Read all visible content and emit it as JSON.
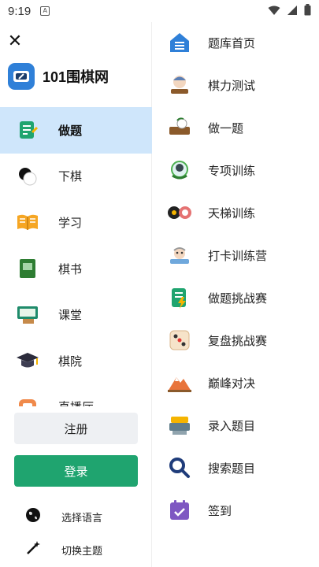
{
  "status_bar": {
    "time": "9:19",
    "notification_letter": "A"
  },
  "drawer": {
    "brand_name": "101围棋网",
    "menu": [
      {
        "label": "做题",
        "icon": "practice-icon",
        "active": true
      },
      {
        "label": "下棋",
        "icon": "go-stones-icon",
        "active": false
      },
      {
        "label": "学习",
        "icon": "open-book-icon",
        "active": false
      },
      {
        "label": "棋书",
        "icon": "go-book-icon",
        "active": false
      },
      {
        "label": "课堂",
        "icon": "classroom-icon",
        "active": false
      },
      {
        "label": "棋院",
        "icon": "graduation-cap-icon",
        "active": false
      },
      {
        "label": "直播厅",
        "icon": "live-hall-icon",
        "active": false
      }
    ],
    "register_label": "注册",
    "login_label": "登录",
    "language_label": "选择语言",
    "theme_label": "切换主题",
    "colors": {
      "active_bg": "#cfe6fb",
      "login_green": "#1fa46f",
      "register_bg": "#eef0f3"
    }
  },
  "panel": {
    "items": [
      {
        "label": "题库首页",
        "icon": "home-icon"
      },
      {
        "label": "棋力测试",
        "icon": "test-avatar-icon"
      },
      {
        "label": "做一题",
        "icon": "single-problem-icon"
      },
      {
        "label": "专项训练",
        "icon": "special-training-icon"
      },
      {
        "label": "天梯训练",
        "icon": "ladder-training-icon"
      },
      {
        "label": "打卡训练营",
        "icon": "check-in-camp-icon"
      },
      {
        "label": "做题挑战赛",
        "icon": "problem-challenge-icon"
      },
      {
        "label": "复盘挑战赛",
        "icon": "dice-icon"
      },
      {
        "label": "巅峰对决",
        "icon": "mountain-icon"
      },
      {
        "label": "录入题目",
        "icon": "input-problem-icon"
      },
      {
        "label": "搜索题目",
        "icon": "search-icon"
      },
      {
        "label": "签到",
        "icon": "calendar-icon"
      }
    ]
  }
}
